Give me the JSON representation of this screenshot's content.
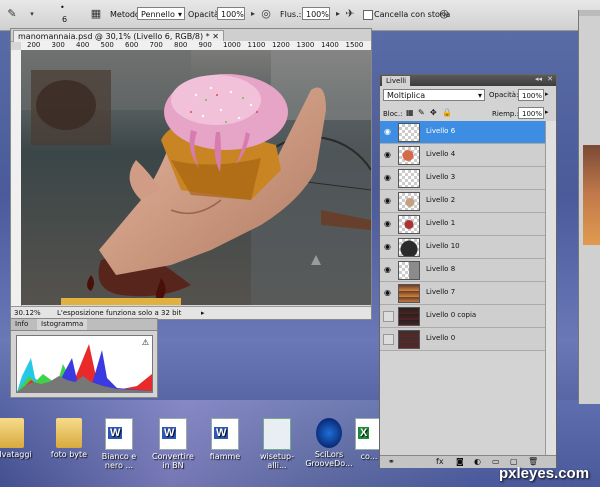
{
  "options_bar": {
    "brush_size": "6",
    "mode_label": "Metodo:",
    "mode_value": "Pennello",
    "opacity_label": "Opacità:",
    "opacity_value": "100%",
    "flow_label": "Flus.:",
    "flow_value": "100%",
    "history_label": "Cancella con storia"
  },
  "document": {
    "tab_title": "manomannaia.psd @ 30,1% (Livello 6, RGB/8) *",
    "ruler_ticks": [
      "200",
      "300",
      "400",
      "500",
      "600",
      "700",
      "800",
      "900",
      "1000",
      "1100",
      "1200",
      "1300",
      "1400",
      "1500"
    ],
    "zoom": "30.12%",
    "status_text": "L'esposizione funziona solo a 32 bit"
  },
  "info_panel": {
    "tabs": [
      "Info",
      "Istogramma"
    ]
  },
  "layers_panel": {
    "title": "Livelli",
    "blend_mode": "Moltiplica",
    "opacity_label": "Opacità:",
    "opacity_value": "100%",
    "lock_label": "Bloc.:",
    "fill_label": "Riemp.:",
    "fill_value": "100%",
    "layers": [
      {
        "name": "Livello 6",
        "visible": true,
        "selected": true
      },
      {
        "name": "Livello 4",
        "visible": true
      },
      {
        "name": "Livello 3",
        "visible": true
      },
      {
        "name": "Livello 2",
        "visible": true
      },
      {
        "name": "Livello 1",
        "visible": true
      },
      {
        "name": "Livello 10",
        "visible": true
      },
      {
        "name": "Livello 8",
        "visible": true
      },
      {
        "name": "Livello 7",
        "visible": true
      },
      {
        "name": "Livello 0 copia",
        "visible": false
      },
      {
        "name": "Livello 0",
        "visible": false
      }
    ]
  },
  "desktop_icons": [
    "salvataggi",
    "foto byte",
    "Bianco e nero ...",
    "Convertire in BN",
    "fiamme",
    "wisetup-alli...",
    "SciLors GrooveDo...",
    "co..."
  ],
  "watermark": "pxleyes.com"
}
